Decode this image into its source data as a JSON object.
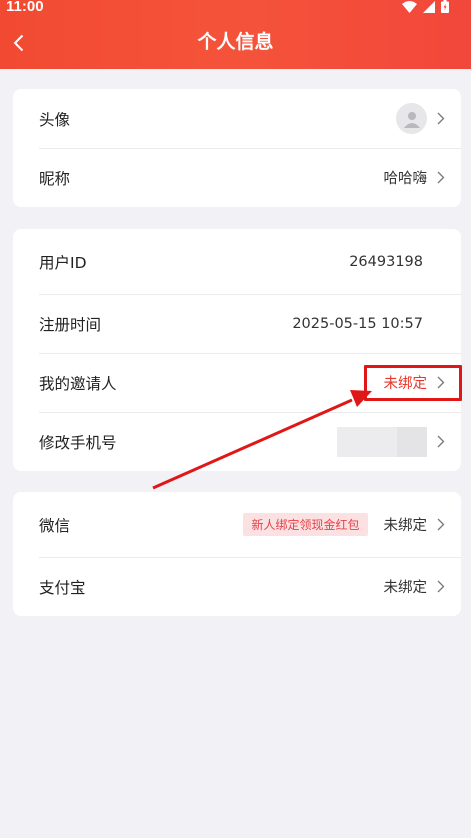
{
  "status_bar": {
    "time": "11:00"
  },
  "nav": {
    "title": "个人信息"
  },
  "group1": {
    "avatar_label": "头像",
    "nickname_label": "昵称",
    "nickname_value": "哈哈嗨"
  },
  "group2": {
    "user_id_label": "用户ID",
    "user_id_value": "26493198",
    "reg_time_label": "注册时间",
    "reg_time_value": "2025-05-15 10:57",
    "inviter_label": "我的邀请人",
    "inviter_value": "未绑定",
    "phone_label": "修改手机号"
  },
  "group3": {
    "wechat_label": "微信",
    "wechat_promo": "新人绑定领现金红包",
    "wechat_value": "未绑定",
    "alipay_label": "支付宝",
    "alipay_value": "未绑定"
  },
  "colors": {
    "header": "#f24a32",
    "accent_red": "#e8372a",
    "annotation_red": "#e01717",
    "background": "#f2f1f6"
  }
}
